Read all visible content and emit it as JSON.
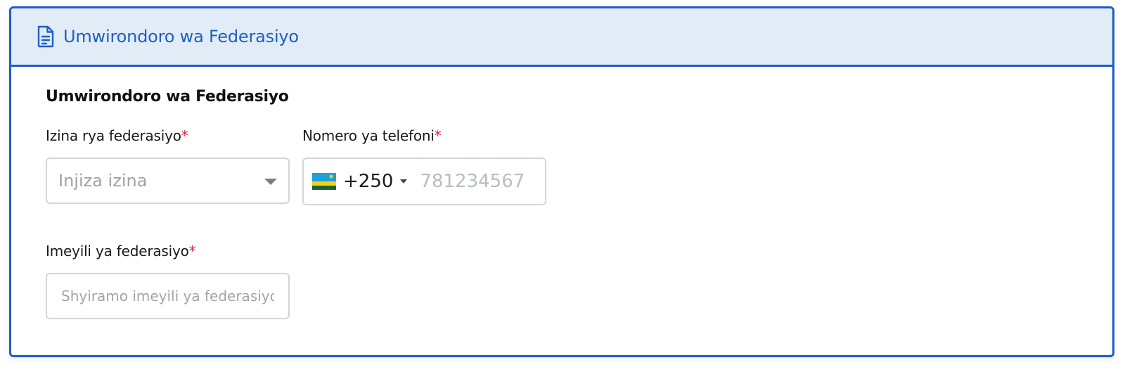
{
  "header": {
    "icon": "document-icon",
    "title": "Umwirondoro wa Federasiyo",
    "accent_color": "#1f5fc3",
    "background_color": "#e1ecf7"
  },
  "form": {
    "section_title": "Umwirondoro wa Federasiyo",
    "name_field": {
      "label": "Izina rya federasiyo",
      "required_mark": "*",
      "placeholder": "Injiza izina"
    },
    "phone_field": {
      "label": "Nomero ya telefoni",
      "required_mark": "*",
      "country_flag": "rwanda-flag-icon",
      "dial_code": "+250",
      "placeholder": "781234567"
    },
    "email_field": {
      "label": "Imeyili ya federasiyo",
      "required_mark": "*",
      "placeholder": "Shyiramo imeyili ya federasiyo"
    },
    "required_color": "#e0233f"
  }
}
